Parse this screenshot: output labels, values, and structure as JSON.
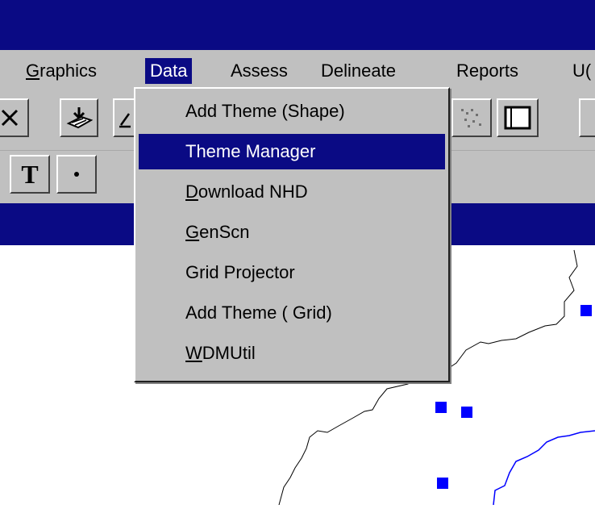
{
  "menubar": {
    "items": [
      {
        "pre": "",
        "ul": "G",
        "post": "raphics"
      },
      {
        "pre": "",
        "ul": "",
        "post": "Data"
      },
      {
        "pre": "",
        "ul": "",
        "post": "Assess"
      },
      {
        "pre": "",
        "ul": "",
        "post": "Delineate"
      },
      {
        "pre": "",
        "ul": "",
        "post": "Reports"
      },
      {
        "pre": "",
        "ul": "",
        "post": "U("
      }
    ]
  },
  "data_menu": {
    "items": [
      {
        "pre": "Add Theme (Shape)",
        "ul": "",
        "post": ""
      },
      {
        "pre": "Theme Manager",
        "ul": "",
        "post": ""
      },
      {
        "pre": "",
        "ul": "D",
        "post": "ownload NHD"
      },
      {
        "pre": "",
        "ul": "G",
        "post": "enScn"
      },
      {
        "pre": "Grid Projector",
        "ul": "",
        "post": ""
      },
      {
        "pre": "Add Theme ( Grid)",
        "ul": "",
        "post": ""
      },
      {
        "pre": "",
        "ul": "W",
        "post": "DMUtil"
      }
    ],
    "selected_index": 1
  },
  "toolbar": {
    "text_tool_label": "T",
    "icons": [
      "zoom-icon",
      "add-theme-icon",
      "pencil-icon",
      "scatter-icon",
      "layout-icon",
      "text-tool-icon",
      "point-tool-icon"
    ]
  },
  "colors": {
    "title_bar": "#0a0a84",
    "selection": "#0a0a84",
    "menu_face": "#c0c0c0",
    "map_points": "#0000ff"
  }
}
